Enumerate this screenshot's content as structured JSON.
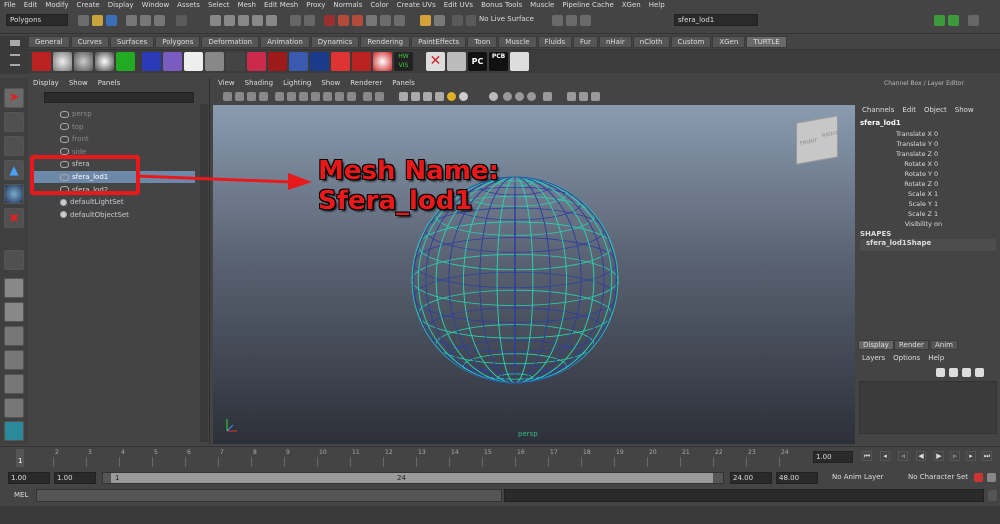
{
  "menubar": [
    "File",
    "Edit",
    "Modify",
    "Create",
    "Display",
    "Window",
    "Assets",
    "Select",
    "Mesh",
    "Edit Mesh",
    "Proxy",
    "Normals",
    "Color",
    "Create UVs",
    "Edit UVs",
    "Bonus Tools",
    "Muscle",
    "Pipeline Cache",
    "XGen",
    "Help"
  ],
  "status": {
    "mode": "Polygons",
    "live_surface": "No Live Surface",
    "object_name": "sfera_lod1"
  },
  "shelf_tabs": [
    "General",
    "Curves",
    "Surfaces",
    "Polygons",
    "Deformation",
    "Animation",
    "Dynamics",
    "Rendering",
    "PaintEffects",
    "Toon",
    "Muscle",
    "Fluids",
    "Fur",
    "nHair",
    "nCloth",
    "Custom",
    "XGen",
    "TURTLE"
  ],
  "shelf_active": "TURTLE",
  "shelf_icon_labels": {
    "vis": "VIS",
    "pc": "PC",
    "pcb": "PCB",
    "hw": "HW"
  },
  "outliner": {
    "menu": [
      "Display",
      "Show",
      "Panels"
    ],
    "items": [
      {
        "label": "persp",
        "style": "grey"
      },
      {
        "label": "top",
        "style": "grey"
      },
      {
        "label": "front",
        "style": "grey"
      },
      {
        "label": "side",
        "style": "grey"
      },
      {
        "label": "sfera",
        "style": "normal"
      },
      {
        "label": "sfera_lod1",
        "style": "sel"
      },
      {
        "label": "sfera_lod2",
        "style": "normal"
      },
      {
        "label": "defaultLightSet",
        "style": "normal"
      },
      {
        "label": "defaultObjectSet",
        "style": "normal"
      }
    ]
  },
  "viewport": {
    "menu": [
      "View",
      "Shading",
      "Lighting",
      "Show",
      "Renderer",
      "Panels"
    ],
    "camera_label": "persp",
    "viewcube": {
      "front": "FRONT",
      "right": "RIGHT"
    }
  },
  "annotation": {
    "line1": "Mesh Name:",
    "line2": "Sfera_lod1",
    "color": "#e8191a"
  },
  "channel_box": {
    "title": "Channel Box / Layer Editor",
    "menu": [
      "Channels",
      "Edit",
      "Object",
      "Show"
    ],
    "object": "sfera_lod1",
    "channels": [
      {
        "name": "Translate X",
        "value": "0"
      },
      {
        "name": "Translate Y",
        "value": "0"
      },
      {
        "name": "Translate Z",
        "value": "0"
      },
      {
        "name": "Rotate X",
        "value": "0"
      },
      {
        "name": "Rotate Y",
        "value": "0"
      },
      {
        "name": "Rotate Z",
        "value": "0"
      },
      {
        "name": "Scale X",
        "value": "1"
      },
      {
        "name": "Scale Y",
        "value": "1"
      },
      {
        "name": "Scale Z",
        "value": "1"
      },
      {
        "name": "Visibility",
        "value": "on"
      }
    ],
    "shapes_header": "SHAPES",
    "shape": "sfera_lod1Shape",
    "layer_tabs": [
      "Display",
      "Render",
      "Anim"
    ],
    "layer_menu": [
      "Layers",
      "Options",
      "Help"
    ]
  },
  "timeline": {
    "ticks": [
      "1",
      "2",
      "3",
      "4",
      "5",
      "6",
      "7",
      "8",
      "9",
      "10",
      "11",
      "12",
      "13",
      "14",
      "15",
      "16",
      "17",
      "18",
      "19",
      "20",
      "21",
      "22",
      "23",
      "24"
    ],
    "current": "1",
    "current_frame_field": "1.00"
  },
  "range": {
    "start": "1.00",
    "start2": "1.00",
    "slider_start": "1",
    "slider_end": "24",
    "end": "24.00",
    "end2": "48.00",
    "anim_layer": "No Anim Layer",
    "char_set": "No Character Set"
  },
  "cmd": {
    "label": "MEL"
  }
}
